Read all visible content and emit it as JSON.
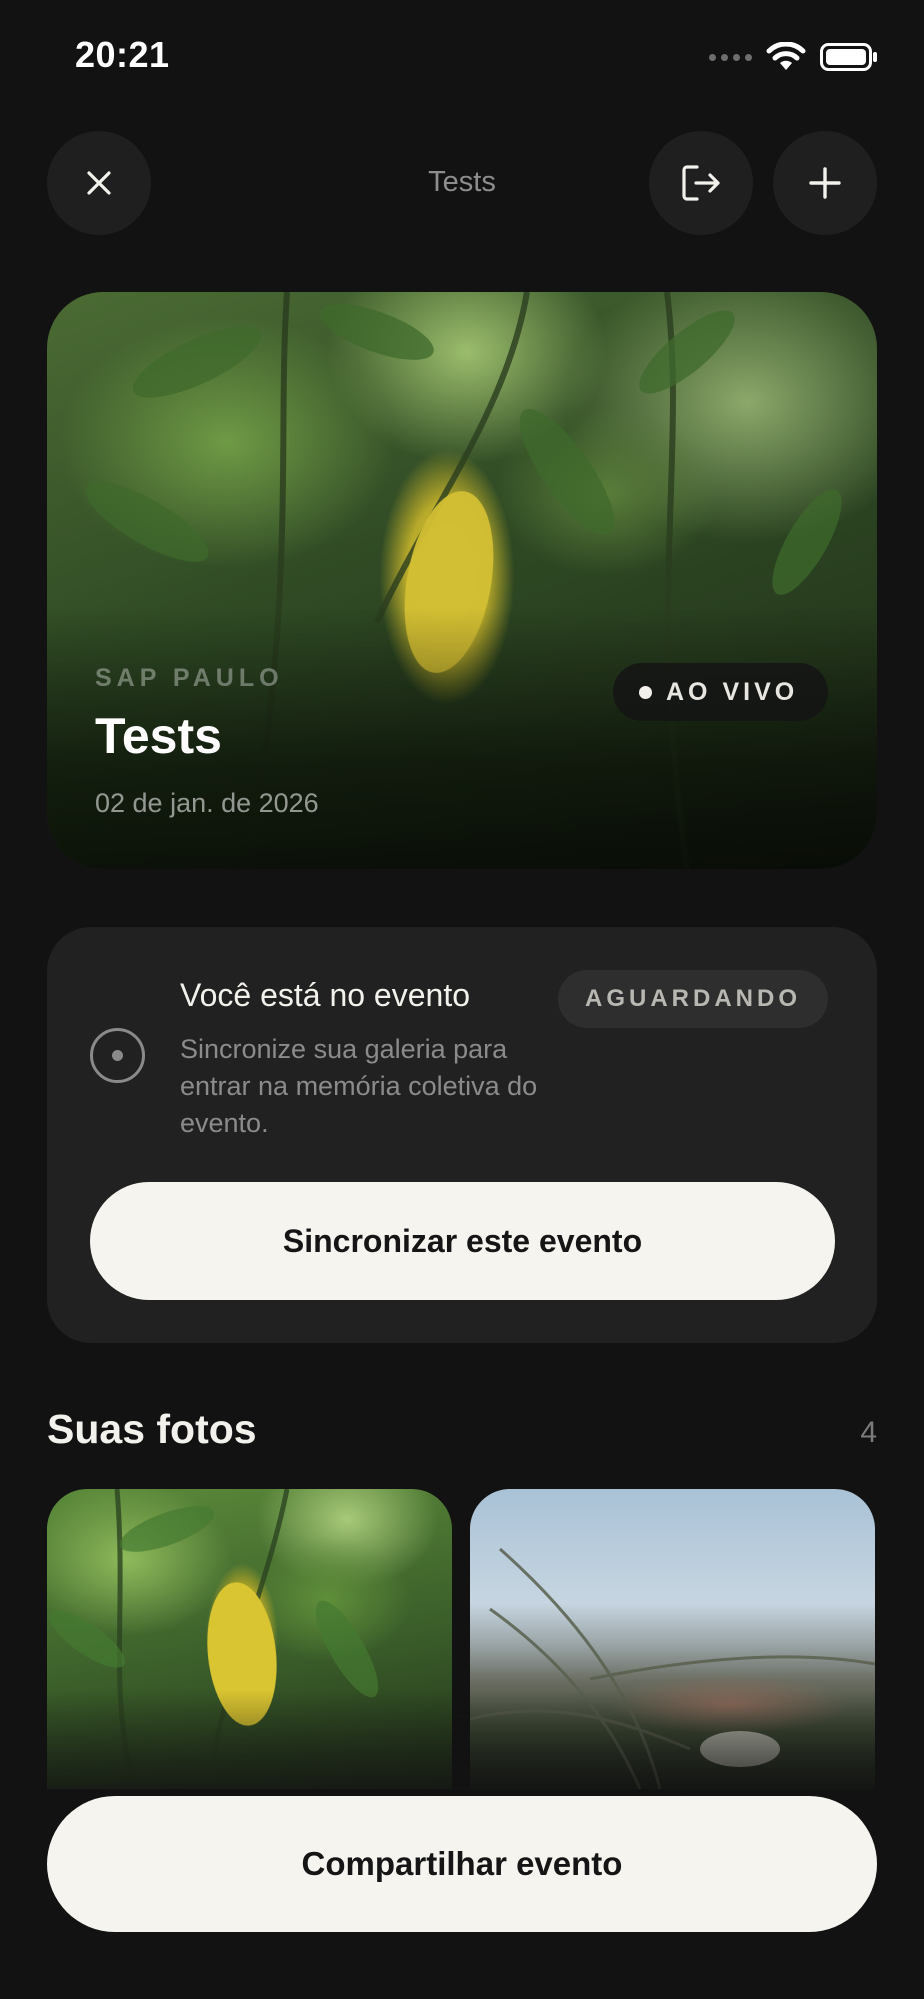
{
  "status_bar": {
    "time": "20:21",
    "icons": [
      "signal-dots-icon",
      "wifi-icon",
      "battery-icon"
    ]
  },
  "nav": {
    "title": "Tests",
    "close_icon": "close-icon",
    "exit_icon": "exit-icon",
    "add_icon": "plus-icon"
  },
  "hero": {
    "location": "SAP PAULO",
    "title": "Tests",
    "date": "02 de jan. de 2026",
    "live_badge": "AO VIVO"
  },
  "event_card": {
    "title": "Você está no evento",
    "description": "Sincronize sua galeria para entrar na memória coletiva do evento.",
    "status": "AGUARDANDO",
    "sync_button": "Sincronizar este evento"
  },
  "photos": {
    "title": "Suas fotos",
    "count": "4"
  },
  "share_button": "Compartilhar evento",
  "colors": {
    "background": "#121212",
    "card": "#212121",
    "button": "#f6f4ee",
    "muted_text": "#8b8b8b"
  }
}
